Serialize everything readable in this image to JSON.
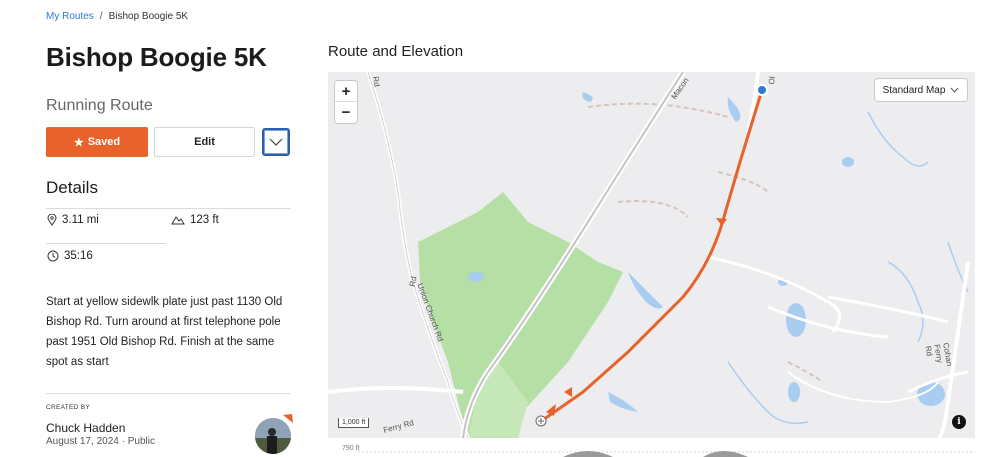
{
  "breadcrumb": {
    "root": "My Routes",
    "separator": "/",
    "current": "Bishop Boogie 5K"
  },
  "route": {
    "title": "Bishop Boogie 5K",
    "type": "Running Route"
  },
  "actions": {
    "saved_label": "Saved",
    "edit_label": "Edit"
  },
  "details": {
    "heading": "Details",
    "distance": "3.11 mi",
    "elevation_gain": "123 ft",
    "duration": "35:16",
    "description": "Start at yellow sidewlk plate just past 1130 Old Bishop Rd. Turn around at first telephone pole past 1951 Old Bishop Rd. Finish at the same spot as start"
  },
  "creator": {
    "label": "CREATED BY",
    "name": "Chuck Hadden",
    "meta": "August 17, 2024 · Public"
  },
  "map": {
    "heading": "Route and Elevation",
    "zoom_in": "+",
    "zoom_out": "−",
    "map_style": "Standard Map",
    "scale": "1,000 ft",
    "info": "i",
    "road_labels": [
      "Union Church Rd",
      "Macon",
      "Cohan Ferry Rd",
      "Rd",
      "Ferry Rd",
      "Ol"
    ],
    "elevation_label": "790 ft"
  },
  "colors": {
    "accent": "#e8632b",
    "link": "#2b7bd6",
    "route": "#e8632b",
    "park": "#b6dfa6",
    "water": "#a9cdf0"
  }
}
